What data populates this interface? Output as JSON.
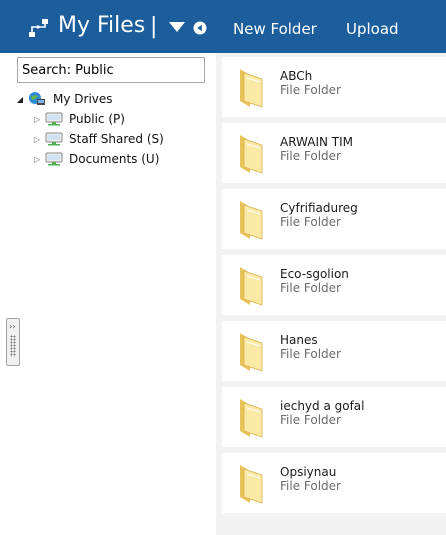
{
  "header": {
    "title": "My Files",
    "separator": "|",
    "new_folder_label": "New Folder",
    "upload_label": "Upload",
    "background_color": "#1c5e9c",
    "logo_icon": "network-share-icon",
    "dropdown_icon": "triangle-down-icon",
    "back_icon": "back-circle-icon"
  },
  "sidebar": {
    "search_value": "Search: Public",
    "root": {
      "label": "My Drives",
      "icon": "my-drives-icon",
      "expanded": true
    },
    "drives": [
      {
        "label": "Public (P)",
        "icon": "network-drive-icon"
      },
      {
        "label": "Staff Shared (S)",
        "icon": "network-drive-icon"
      },
      {
        "label": "Documents (U)",
        "icon": "network-drive-icon"
      }
    ]
  },
  "files": [
    {
      "name": "ABCh",
      "type": "File Folder"
    },
    {
      "name": "ARWAIN TIM",
      "type": "File Folder"
    },
    {
      "name": "Cyfrifiadureg",
      "type": "File Folder"
    },
    {
      "name": "Eco-sgolion",
      "type": "File Folder"
    },
    {
      "name": "Hanes",
      "type": "File Folder"
    },
    {
      "name": "iechyd a gofal",
      "type": "File Folder"
    },
    {
      "name": "Opsiynau",
      "type": "File Folder"
    }
  ],
  "colors": {
    "folder_light": "#fbe9a6",
    "folder_dark": "#e8c35a",
    "list_background": "#f2f2f2"
  }
}
